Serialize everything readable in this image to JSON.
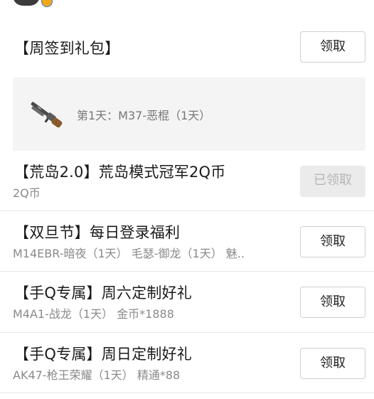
{
  "weekly": {
    "title": "【周签到礼包】",
    "button": "领取",
    "reward_text": "第1天：M37-恶棍（1天）",
    "reward_icon": "shotgun-icon"
  },
  "items": [
    {
      "title": "【荒岛2.0】荒岛模式冠军2Q币",
      "subtitle": "2Q币",
      "button": "已领取",
      "claimed": true
    },
    {
      "title": "【双旦节】每日登录福利",
      "subtitle": "M14EBR-暗夜（1天） 毛瑟-御龙（1天） 魅..",
      "button": "领取",
      "claimed": false
    },
    {
      "title": "【手Q专属】周六定制好礼",
      "subtitle": "M4A1-战龙（1天） 金币*1888",
      "button": "领取",
      "claimed": false
    },
    {
      "title": "【手Q专属】周日定制好礼",
      "subtitle": "AK47-枪王荣耀（1天） 精通*88",
      "button": "领取",
      "claimed": false
    }
  ]
}
